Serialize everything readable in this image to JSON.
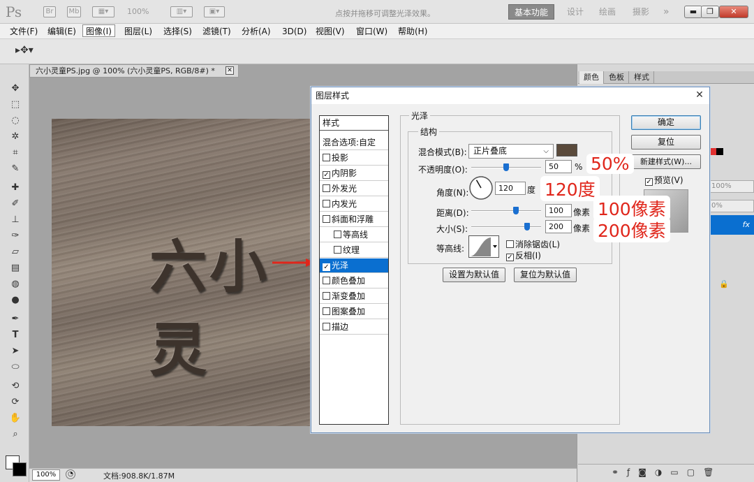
{
  "app": {
    "logo": "Ps",
    "bridge": "Br",
    "minibridge": "Mb",
    "zoom": "100%"
  },
  "workspaces": [
    {
      "label": "基本功能"
    },
    {
      "label": "设计"
    },
    {
      "label": "绘画"
    },
    {
      "label": "摄影"
    },
    {
      "label": "»"
    }
  ],
  "menu": [
    "文件(F)",
    "编辑(E)",
    "图像(I)",
    "图层(L)",
    "选择(S)",
    "滤镜(T)",
    "分析(A)",
    "3D(D)",
    "视图(V)",
    "窗口(W)",
    "帮助(H)"
  ],
  "options_hint": "点按并拖移可调整光泽效果。",
  "document": {
    "tab": "六小灵童PS.jpg @ 100% (六小灵童PS, RGB/8#) *",
    "canvas_text": "六小灵",
    "zoom": "100%",
    "doc_size": "文档:908.8K/1.87M"
  },
  "panels": {
    "tabs": [
      "颜色",
      "色板",
      "样式"
    ],
    "opacity1": "100%",
    "opacity2": "0%",
    "fx": "fx"
  },
  "dialog": {
    "title": "图层样式",
    "style_list": {
      "header": "样式",
      "blend_options": "混合选项:自定",
      "items": [
        {
          "label": "投影",
          "checked": false
        },
        {
          "label": "内阴影",
          "checked": true
        },
        {
          "label": "外发光",
          "checked": false
        },
        {
          "label": "内发光",
          "checked": false
        },
        {
          "label": "斜面和浮雕",
          "checked": false
        },
        {
          "label": "等高线",
          "checked": false
        },
        {
          "label": "纹理",
          "checked": false
        },
        {
          "label": "光泽",
          "checked": true
        },
        {
          "label": "颜色叠加",
          "checked": false
        },
        {
          "label": "渐变叠加",
          "checked": false
        },
        {
          "label": "图案叠加",
          "checked": false
        },
        {
          "label": "描边",
          "checked": false
        }
      ]
    },
    "satin": {
      "group_title": "光泽",
      "structure_title": "结构",
      "blend_mode_label": "混合模式(B):",
      "blend_mode_value": "正片叠底",
      "color": "#5a4a3b",
      "opacity_label": "不透明度(O):",
      "opacity_value": "50",
      "opacity_unit": "%",
      "opacity_level": 0.5,
      "angle_label": "角度(N):",
      "angle_value": "120",
      "angle_unit": "度",
      "distance_label": "距离(D):",
      "distance_value": "100",
      "distance_unit": "像素",
      "size_label": "大小(S):",
      "size_value": "200",
      "size_unit": "像素",
      "contour_label": "等高线:",
      "anti_alias_label": "消除锯齿(L)",
      "anti_alias_checked": false,
      "invert_label": "反相(I)",
      "invert_checked": true,
      "make_default": "设置为默认值",
      "reset_default": "复位为默认值"
    },
    "buttons": {
      "ok": "确定",
      "reset": "复位",
      "new_style": "新建样式(W)...",
      "preview": "预览(V)",
      "preview_checked": true
    }
  },
  "annotations": [
    "50%",
    "120度",
    "100像素",
    "200像素"
  ],
  "colors": {
    "accent": "#0a6fd0",
    "annotation": "#e0261b"
  }
}
